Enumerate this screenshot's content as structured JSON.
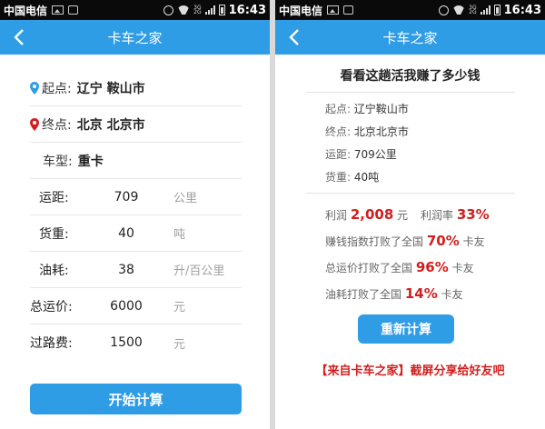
{
  "status": {
    "carrier": "中国电信",
    "net_top": "3G",
    "net_bottom": "2G",
    "time": "16:43"
  },
  "app": {
    "title": "卡车之家"
  },
  "form": {
    "start": {
      "label": "起点:",
      "value": "辽宁 鞍山市"
    },
    "end": {
      "label": "终点:",
      "value": "北京 北京市"
    },
    "truck_type": {
      "label": "车型:",
      "value": "重卡"
    },
    "fields": [
      {
        "label": "运距:",
        "value": "709",
        "unit": "公里"
      },
      {
        "label": "货重:",
        "value": "40",
        "unit": "吨"
      },
      {
        "label": "油耗:",
        "value": "38",
        "unit": "升/百公里"
      },
      {
        "label": "总运价:",
        "value": "6000",
        "unit": "元"
      },
      {
        "label": "过路费:",
        "value": "1500",
        "unit": "元"
      }
    ],
    "submit_label": "开始计算"
  },
  "result": {
    "heading": "看看这趟活我赚了多少钱",
    "info": [
      {
        "label": "起点:",
        "value": "辽宁鞍山市"
      },
      {
        "label": "终点:",
        "value": "北京北京市"
      },
      {
        "label": "运距:",
        "value": "709公里"
      },
      {
        "label": "货重:",
        "value": "40吨"
      }
    ],
    "profit_label": "利润",
    "profit_value": "2,008",
    "profit_unit": "元",
    "margin_label": "利润率",
    "margin_value": "33%",
    "index_pre": "赚钱指数打败了全国",
    "index_value": "70%",
    "index_post": "卡友",
    "freight_pre": "总运价打败了全国",
    "freight_value": "96%",
    "freight_post": "卡友",
    "fuel_pre": "油耗打败了全国",
    "fuel_value": "14%",
    "fuel_post": "卡友",
    "recalc_label": "重新计算",
    "share_text": "【来自卡车之家】截屏分享给好友吧"
  },
  "colors": {
    "accent": "#2f9ce6",
    "highlight": "#d21e1e",
    "start_pin": "#2f9ce6",
    "end_pin": "#d21e1e"
  }
}
